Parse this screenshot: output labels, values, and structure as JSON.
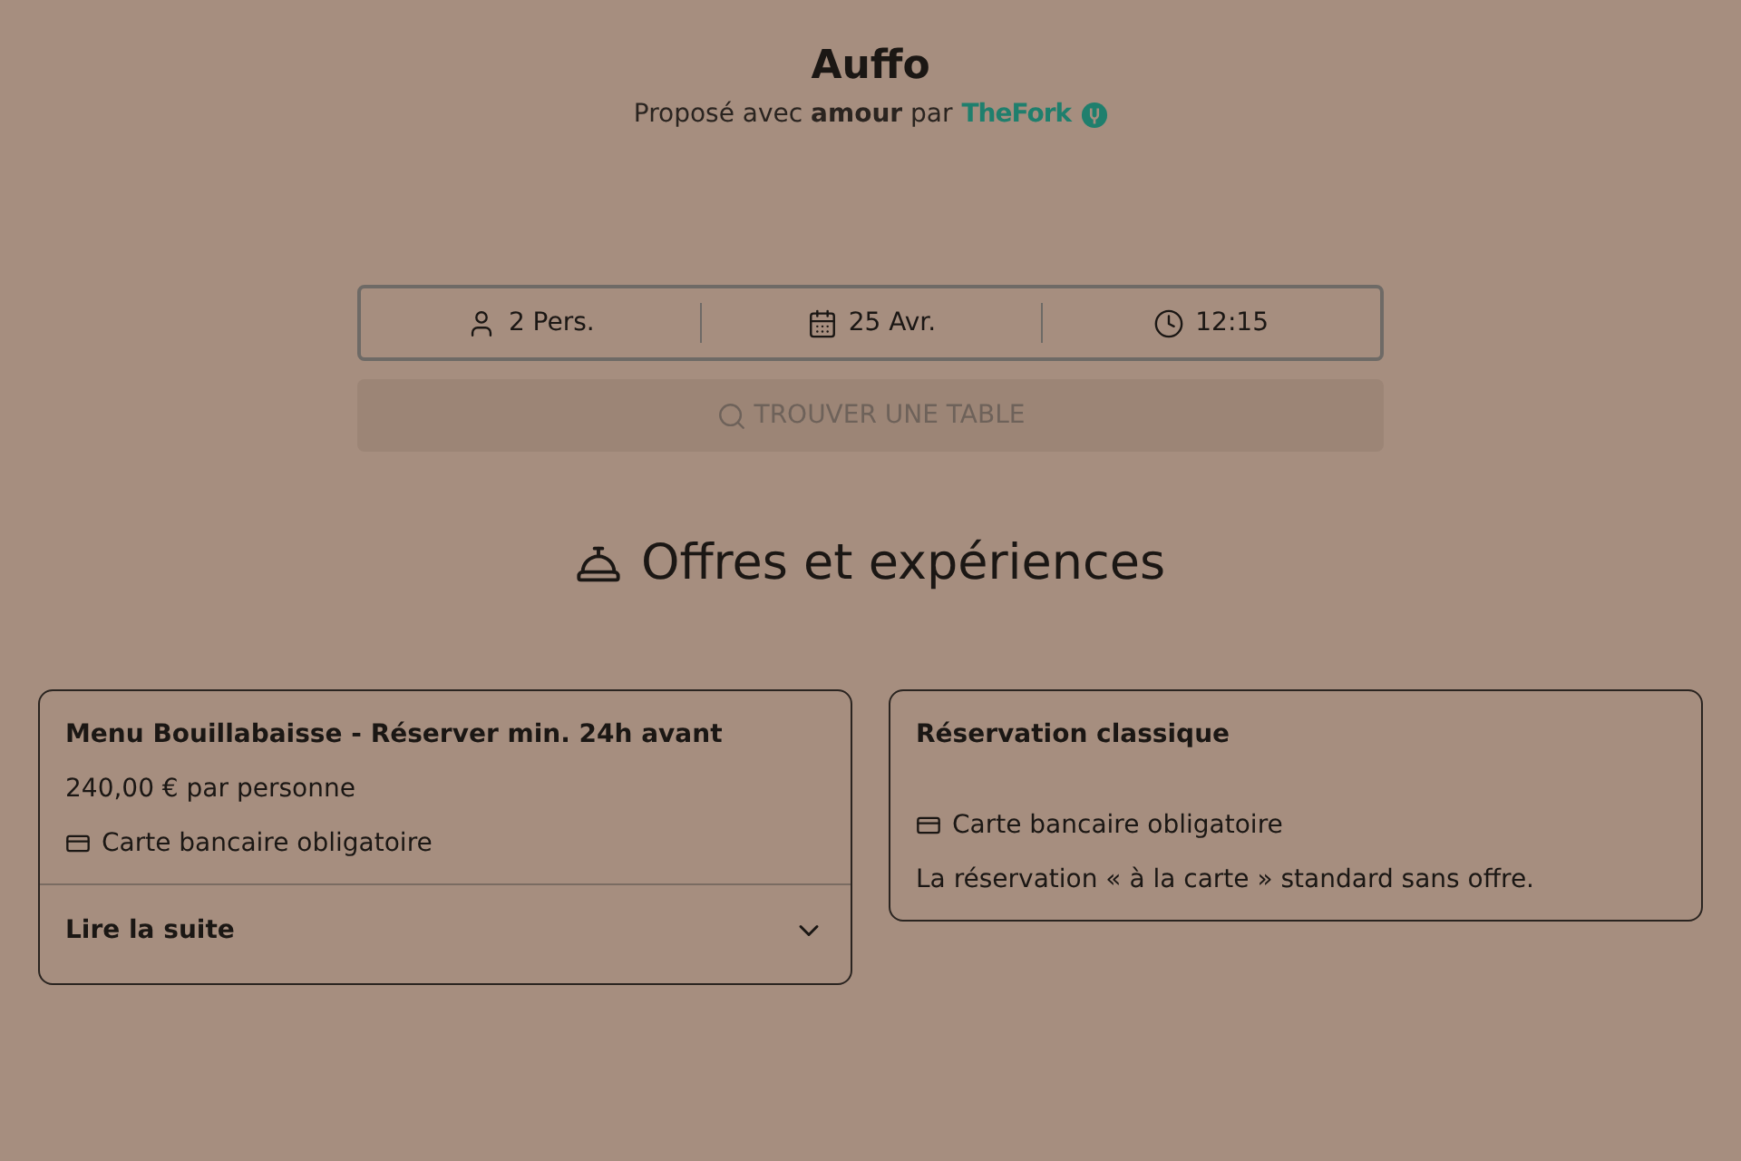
{
  "header": {
    "title": "Auffo",
    "tagline": "Proposé avec **amour** par",
    "brand": "TheFork"
  },
  "search": {
    "fields": [
      {
        "kind": "guests",
        "value": "2 Pers."
      },
      {
        "kind": "date",
        "value": "25 Avr."
      },
      {
        "kind": "time",
        "value": "12:15"
      }
    ],
    "button": {
      "label": "TROUVER UNE TABLE",
      "disabled": true
    }
  },
  "offers_heading": "Offres et expériences",
  "offers": [
    {
      "title": "Menu Bouillabaisse - Réserver min. 24h avant",
      "price": "240,00 € par personne",
      "card_note": "Carte bancaire obligatoire",
      "read_more": {
        "label": "Lire la suite",
        "expanded": false
      }
    },
    {
      "title": "Réservation classique",
      "card_note": "Carte bancaire obligatoire",
      "description": "La réservation « à la carte » standard sans offre."
    }
  ]
}
